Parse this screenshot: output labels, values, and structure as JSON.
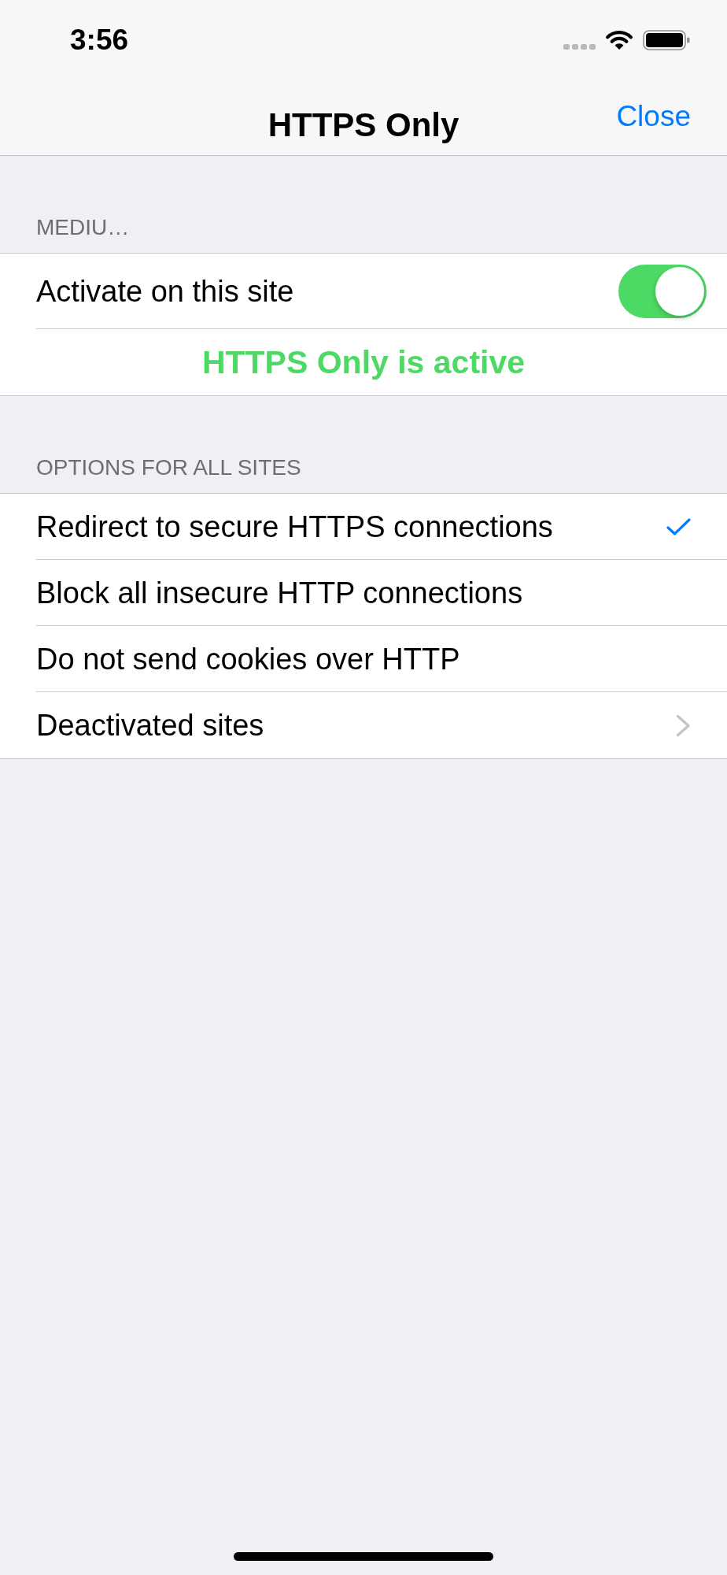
{
  "status_bar": {
    "time": "3:56"
  },
  "nav_bar": {
    "title": "HTTPS Only",
    "action": "Close"
  },
  "sections": [
    {
      "header": "MEDIU…",
      "rows": [
        {
          "kind": "toggle",
          "label": "Activate on this site",
          "on": true
        },
        {
          "kind": "status",
          "label": "HTTPS Only is active"
        }
      ]
    },
    {
      "header": "OPTIONS FOR ALL SITES",
      "rows": [
        {
          "kind": "option",
          "label": "Redirect to secure HTTPS connections",
          "selected": true
        },
        {
          "kind": "option",
          "label": "Block all insecure HTTP connections",
          "selected": false
        },
        {
          "kind": "option",
          "label": "Do not send cookies over HTTP",
          "selected": false
        },
        {
          "kind": "link",
          "label": "Deactivated sites"
        }
      ]
    }
  ]
}
